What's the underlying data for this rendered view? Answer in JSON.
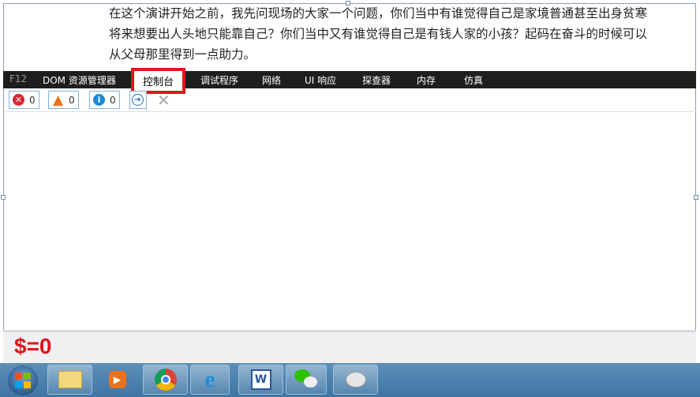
{
  "document": {
    "lines": [
      "在这个演讲开始之前，我先问现场的大家一个问题，你们当中有谁觉得自己是家境普通甚至出身贫寒",
      "将来想要出人头地只能靠自己？你们当中又有谁觉得自己是有钱人家的小孩？起码在奋斗的时候可以",
      "从父母那里得到一点助力。"
    ]
  },
  "devtools": {
    "f12": "F12",
    "tabs": [
      "DOM 资源管理器",
      "控制台",
      "调试程序",
      "网络",
      "UI 响应",
      "探查器",
      "内存",
      "仿真"
    ],
    "active_tab": "控制台",
    "errors": "0",
    "warnings": "0",
    "info": "0"
  },
  "console": {
    "prompt": "$=0"
  },
  "taskbar": {
    "apps": [
      "start",
      "file-explorer",
      "media-player",
      "chrome",
      "internet-explorer",
      "word",
      "wechat",
      "paint"
    ]
  },
  "colors": {
    "highlight": "#e0141b",
    "toolbar": "#1e1e1e"
  }
}
